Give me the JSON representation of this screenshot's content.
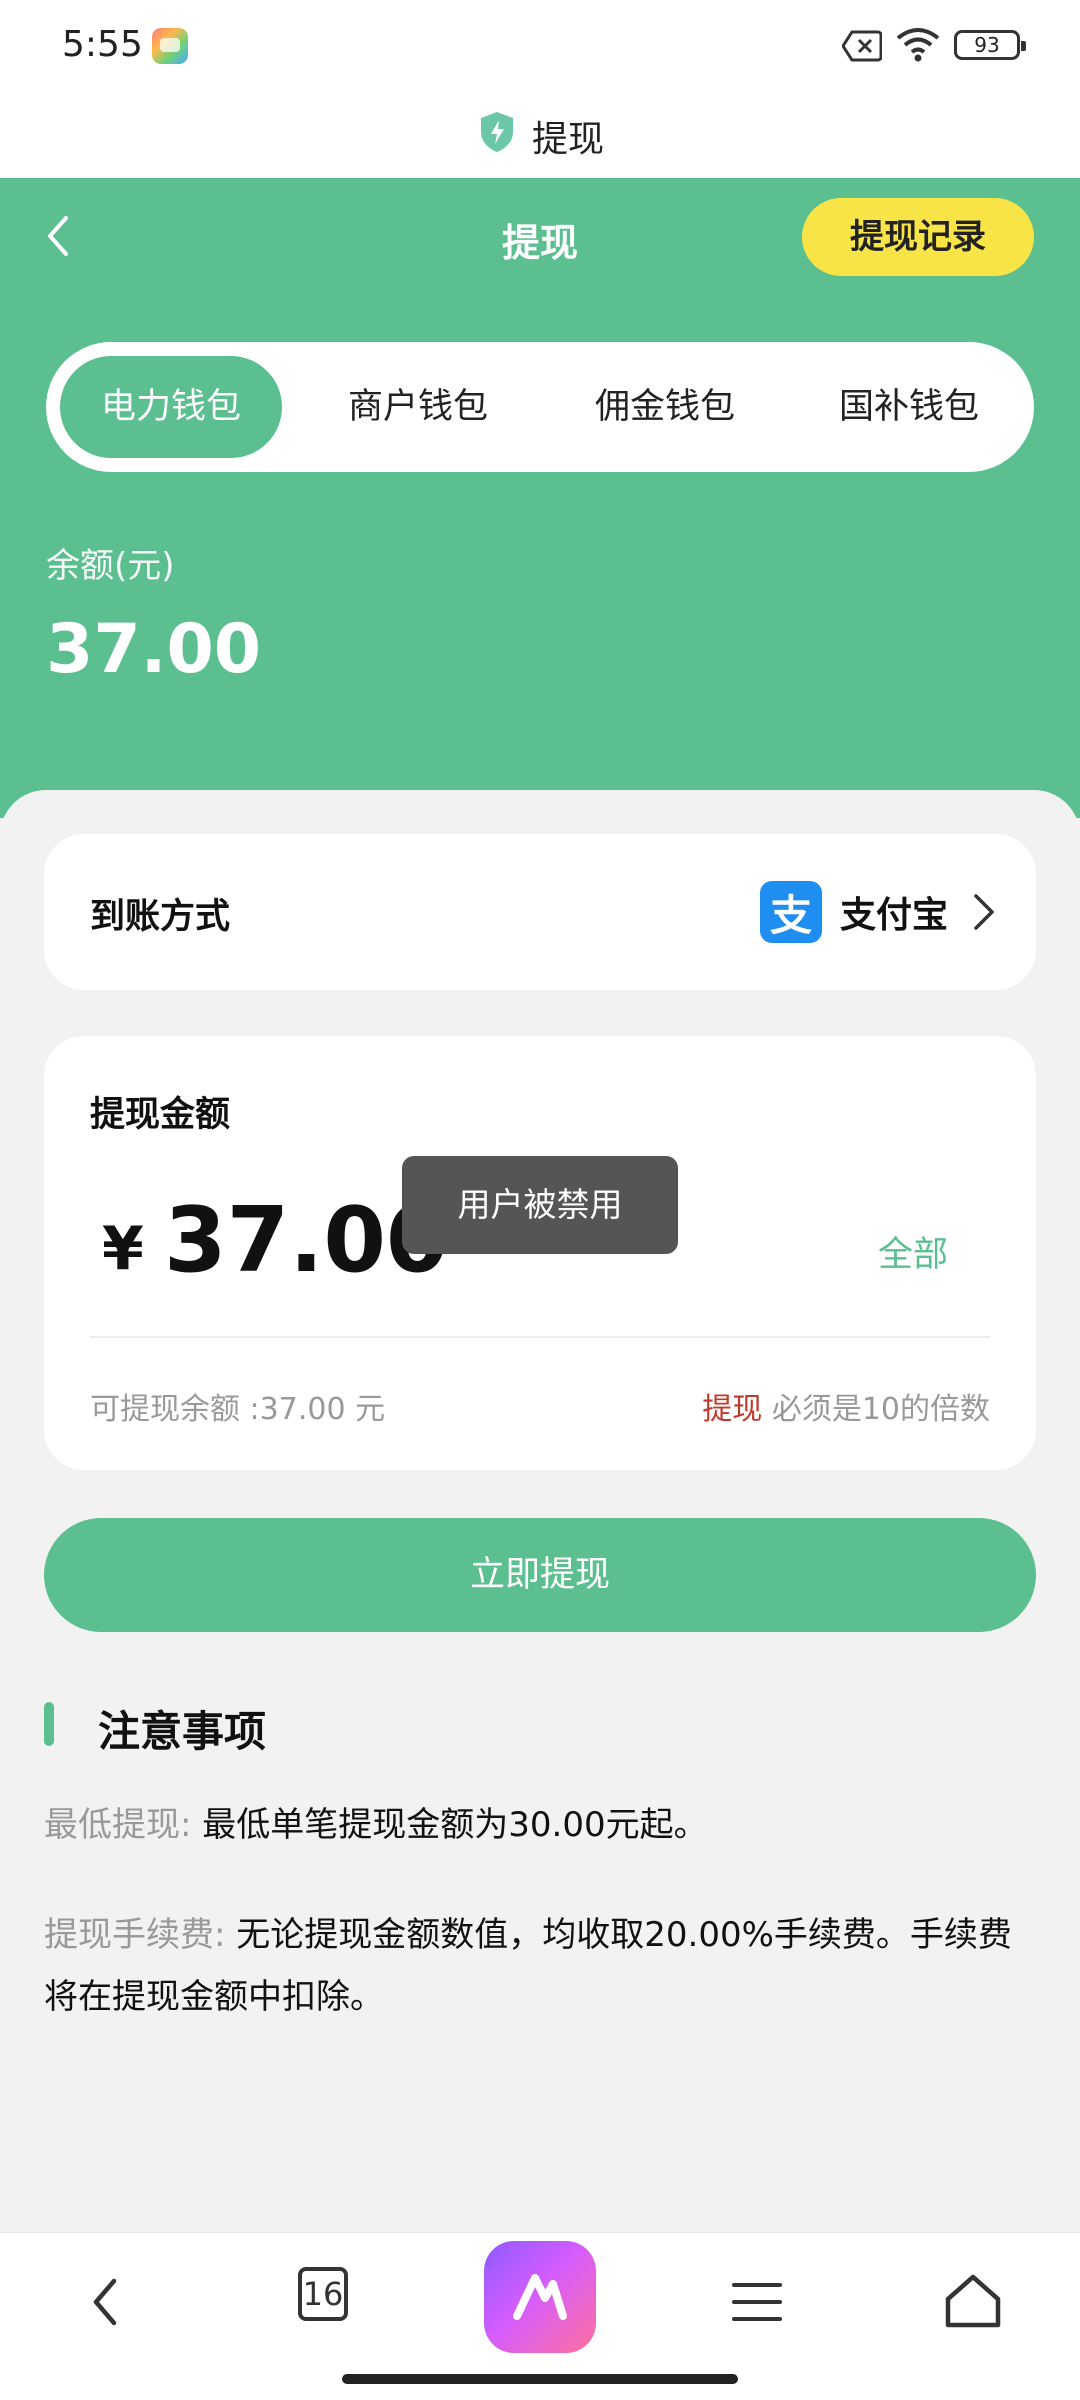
{
  "status_bar": {
    "time": "5:55",
    "battery": "93"
  },
  "browser": {
    "page_title": "提现",
    "tab_count": "16"
  },
  "header": {
    "title": "提现",
    "record_button": "提现记录",
    "tabs": [
      {
        "label": "电力钱包",
        "active": true
      },
      {
        "label": "商户钱包",
        "active": false
      },
      {
        "label": "佣金钱包",
        "active": false
      },
      {
        "label": "国补钱包",
        "active": false
      }
    ],
    "balance_label": "余额(元)",
    "balance_value": "37.00"
  },
  "payout_method": {
    "label": "到账方式",
    "method_name": "支付宝",
    "icon_glyph": "支"
  },
  "amount_card": {
    "title": "提现金额",
    "currency": "¥",
    "amount": "37.00",
    "all_button": "全部",
    "available_text": "可提现余额 :37.00 元",
    "rule_prefix": "提现",
    "rule_text": " 必须是10的倍数"
  },
  "toast": "用户被禁用",
  "submit_button": "立即提现",
  "notice": {
    "title": "注意事项",
    "items": [
      {
        "key": "最低提现:",
        "text": "最低单笔提现金额为30.00元起。"
      },
      {
        "key": "提现手续费:",
        "text": "无论提现金额数值，均收取20.00%手续费。手续费将在提现金额中扣除。"
      }
    ]
  },
  "colors": {
    "primary": "#5bbf8f",
    "accent_yellow": "#f8e447",
    "alipay_blue": "#1e8ef0",
    "warning_red": "#c0392b"
  }
}
